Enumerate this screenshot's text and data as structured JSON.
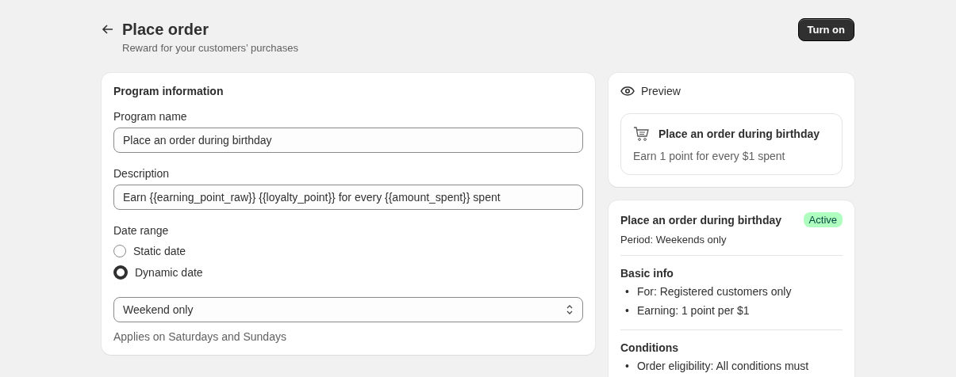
{
  "header": {
    "title": "Place order",
    "subtitle": "Reward for your customers’ purchases",
    "action": "Turn on"
  },
  "program_information": {
    "title": "Program information",
    "fields": [
      {
        "label": "Program name",
        "value": "Place an order during birthday"
      },
      {
        "label": "Description",
        "value": "Earn {{earning_point_raw}} {{loyalty_point}} for every {{amount_spent}} spent"
      }
    ],
    "date_range": {
      "label": "Date range",
      "options": [
        {
          "label": "Static date",
          "selected": false
        },
        {
          "label": "Dynamic date",
          "selected": true
        }
      ],
      "select": {
        "value": "Weekend only"
      },
      "help": "Applies on Saturdays and Sundays"
    }
  },
  "preview": {
    "title": "Preview",
    "card": {
      "title": "Place an order during birthday",
      "text": "Earn 1 point for every $1 spent"
    }
  },
  "summary": {
    "title": "Place an order during birthday",
    "status": "Active",
    "period": "Period: Weekends only",
    "sections": [
      {
        "title": "Basic info",
        "items": [
          {
            "marker": "•",
            "text": "For: Registered customers only"
          },
          {
            "marker": "•",
            "text": "Earning: 1 point per $1"
          }
        ]
      },
      {
        "title": "Conditions",
        "items": [
          {
            "marker": "•",
            "text": "Order eligibility: All conditions must"
          }
        ]
      }
    ]
  }
}
